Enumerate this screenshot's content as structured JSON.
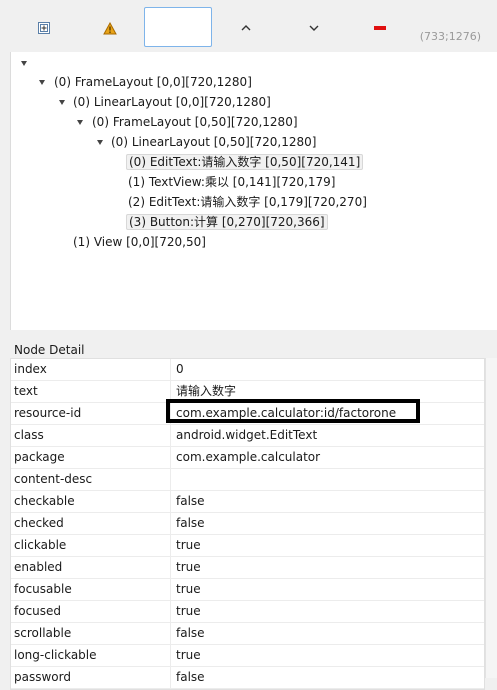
{
  "toolbar": {
    "search_value": "",
    "coordinate": "(733;1276)",
    "icons": [
      "expand-all-icon",
      "warning-icon",
      "previous-icon",
      "next-icon",
      "remove-icon"
    ]
  },
  "tree": {
    "nodes": [
      {
        "label": "(0) FrameLayout [0,0][720,1280]"
      },
      {
        "label": "(0) LinearLayout [0,0][720,1280]"
      },
      {
        "label": "(0) FrameLayout [0,50][720,1280]"
      },
      {
        "label": "(0) LinearLayout [0,50][720,1280]"
      },
      {
        "label": "(0) EditText:请输入数字 [0,50][720,141]"
      },
      {
        "label": "(1) TextView:乘以 [0,141][720,179]"
      },
      {
        "label": "(2) EditText:请输入数字 [0,179][720,270]"
      },
      {
        "label": "(3) Button:计算 [0,270][720,366]"
      },
      {
        "label": "(1) View [0,0][720,50]"
      }
    ]
  },
  "detail": {
    "title": "Node Detail",
    "rows": [
      {
        "key": "index",
        "value": "0"
      },
      {
        "key": "text",
        "value": "请输入数字"
      },
      {
        "key": "resource-id",
        "value": "com.example.calculator:id/factorone"
      },
      {
        "key": "class",
        "value": "android.widget.EditText"
      },
      {
        "key": "package",
        "value": "com.example.calculator"
      },
      {
        "key": "content-desc",
        "value": ""
      },
      {
        "key": "checkable",
        "value": "false"
      },
      {
        "key": "checked",
        "value": "false"
      },
      {
        "key": "clickable",
        "value": "true"
      },
      {
        "key": "enabled",
        "value": "true"
      },
      {
        "key": "focusable",
        "value": "true"
      },
      {
        "key": "focused",
        "value": "true"
      },
      {
        "key": "scrollable",
        "value": "false"
      },
      {
        "key": "long-clickable",
        "value": "true"
      },
      {
        "key": "password",
        "value": "false"
      }
    ]
  },
  "colors": {
    "warning": "#e8a317",
    "remove": "#e01010",
    "accent": "#7eb4ea"
  }
}
